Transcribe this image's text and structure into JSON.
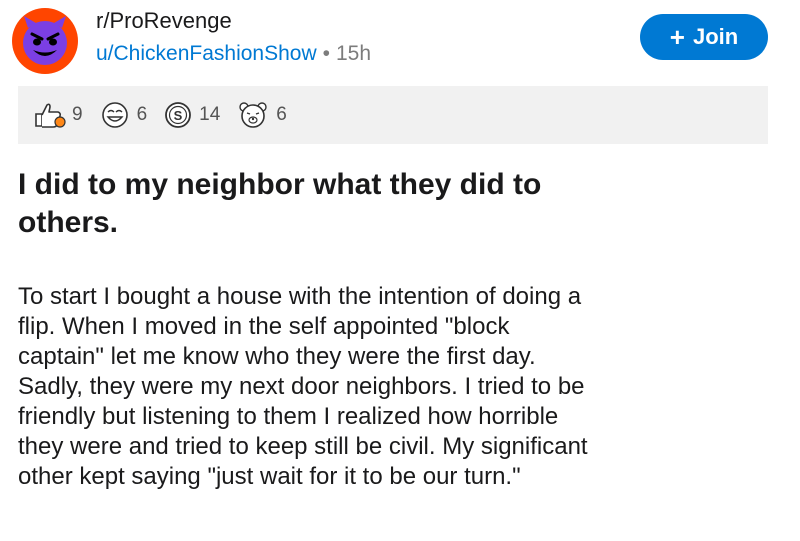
{
  "post": {
    "subreddit": "r/ProRevenge",
    "username": "u/ChickenFashionShow",
    "separator": "•",
    "time_ago": "15h",
    "join_label": "Join",
    "join_icon": "plus-icon",
    "title_lines": [
      "I did to my neighbor what they did to",
      "others."
    ],
    "body_lines": [
      "To start I bought a house with the intention of doing a",
      "flip.  When I moved in the self appointed \"block",
      "captain\" let me know who they were the first day.",
      "Sadly, they were my next door neighbors.  I tried to be",
      "friendly but listening to them I realized how horrible",
      "they were and tried to keep still be civil.  My significant",
      "other kept saying \"just wait for it to be our turn.\""
    ]
  },
  "awards": [
    {
      "icon": "thumbs-up-award-icon",
      "count": "9"
    },
    {
      "icon": "laughing-face-award-icon",
      "count": "6"
    },
    {
      "icon": "silver-coin-award-icon",
      "count": "14"
    },
    {
      "icon": "bear-face-award-icon",
      "count": "6"
    }
  ],
  "colors": {
    "brand_orange": "#ff4500",
    "join_blue": "#0079d3",
    "username_blue": "#0079d3",
    "award_bar_bg": "#f1f1f1",
    "avatar_face": "#7b3fe4"
  }
}
